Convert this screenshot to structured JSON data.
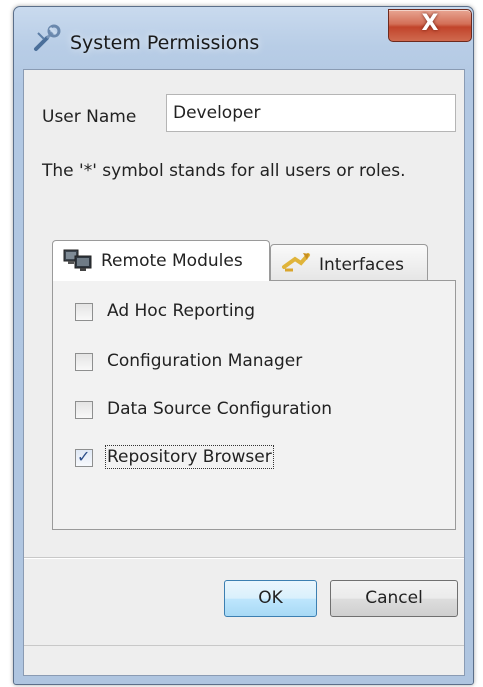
{
  "window": {
    "title": "System Permissions",
    "close_label": "X"
  },
  "form": {
    "username_label": "User Name",
    "username_value": "Developer",
    "hint": "The '*' symbol stands for all users or roles."
  },
  "tabs": [
    {
      "label": "Remote Modules",
      "icon": "computers-icon",
      "active": true
    },
    {
      "label": "Interfaces",
      "icon": "interfaces-icon",
      "active": false
    }
  ],
  "modules": [
    {
      "label": "Ad Hoc Reporting",
      "checked": false
    },
    {
      "label": "Configuration Manager",
      "checked": false
    },
    {
      "label": "Data Source Configuration",
      "checked": false
    },
    {
      "label": "Repository Browser",
      "checked": true
    }
  ],
  "buttons": {
    "ok": "OK",
    "cancel": "Cancel"
  },
  "colors": {
    "close_button": "#c8543a",
    "ok_border": "#3c7fb1",
    "check_mark": "#2c4f8a"
  }
}
